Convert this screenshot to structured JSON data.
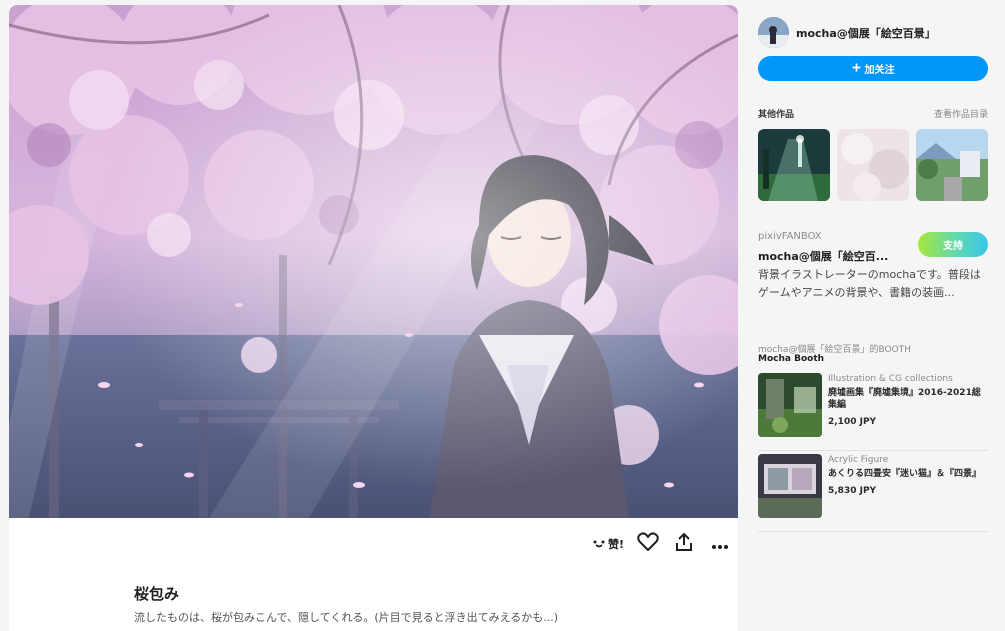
{
  "artwork": {
    "title": "桜包み",
    "caption": "流したものは、桜が包みこんで、隠してくれる。(片目で見ると浮き出てみえるかも...)"
  },
  "actions": {
    "like_label": "赞!"
  },
  "author": {
    "name": "mocha@個展「絵空百景」",
    "follow_label": "加关注"
  },
  "other_works": {
    "title": "其他作品",
    "link_label": "查看作品目录"
  },
  "fanbox": {
    "label": "pixivFANBOX",
    "name": "mocha@個展「絵空百...",
    "support_label": "支持",
    "description": "背景イラストレーターのmochaです。普段はゲームやアニメの背景や、書籍の装画..."
  },
  "booth": {
    "label": "mocha@個展「絵空百景」的BOOTH",
    "name": "Mocha Booth",
    "items": [
      {
        "category": "Illustration & CG collections",
        "title": "廃墟画集『廃墟集境』2016-2021総集編",
        "price": "2,100 JPY"
      },
      {
        "category": "Acrylic Figure",
        "title": "あくりる四畳安『迷い猫』＆『四景』",
        "price": "5,830 JPY"
      }
    ]
  },
  "colors": {
    "accent_blue": "#0096fa",
    "support_gradient_start": "#a6e83c",
    "support_gradient_end": "#38c7e9",
    "sakura_pink": "#d9a8d8"
  },
  "icons": [
    "plus-icon",
    "like-face-icon",
    "heart-icon",
    "share-icon",
    "more-icon"
  ]
}
